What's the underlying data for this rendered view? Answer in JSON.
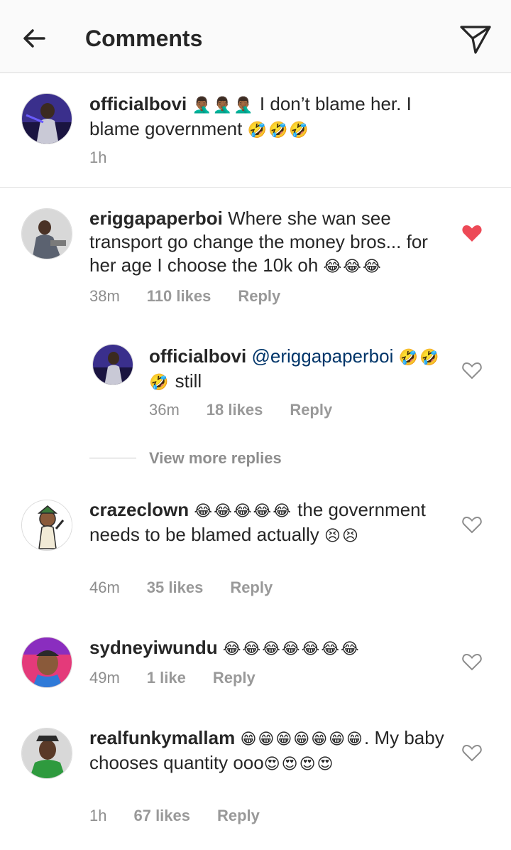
{
  "header": {
    "title": "Comments",
    "back_icon": "arrow-left-icon",
    "send_icon": "paper-plane-icon"
  },
  "colors": {
    "username": "#262626",
    "mention": "#003569",
    "meta": "#8e8e8e",
    "liked_heart": "#ed4956",
    "avatar_ring": "#dcdcdc"
  },
  "caption": {
    "username": "officialbovi",
    "emoji_prefix": "🤦🏾‍♂️🤦🏾‍♂️🤦🏾‍♂️",
    "text": "I don’t blame her. I blame government",
    "emoji_suffix": "🤣🤣🤣",
    "time": "1h"
  },
  "comments": [
    {
      "username": "eriggapaperboi",
      "text": "Where she wan see transport go change the money bros... for her age I choose the 10k oh",
      "emoji": "😂😂😂",
      "time": "38m",
      "likes": "110 likes",
      "reply": "Reply",
      "liked": true
    },
    {
      "username": "officialbovi",
      "mention": "@eriggapaperboi",
      "emoji": "🤣🤣🤣",
      "text": "still",
      "time": "36m",
      "likes": "18 likes",
      "reply": "Reply",
      "liked": false
    },
    {
      "username": "crazeclown",
      "emoji": "😂😂😂😂😂",
      "text_a": "the government needs to be blamed actually",
      "emoji_b": "😣😣",
      "time": "46m",
      "likes": "35 likes",
      "reply": "Reply",
      "liked": false
    },
    {
      "username": "sydneyiwundu",
      "emoji": "😂😂😂😂😂😂😂",
      "time": "49m",
      "likes": "1 like",
      "reply": "Reply",
      "liked": false
    },
    {
      "username": "realfunkymallam",
      "emoji": "😁😁😁😁😁😁😁",
      "text_a": ".",
      "text_b": "My baby chooses quantity ooo",
      "emoji_b": "😍😍😍😍",
      "time": "1h",
      "likes": "67 likes",
      "reply": "Reply",
      "liked": false
    }
  ],
  "view_more": "View more replies"
}
